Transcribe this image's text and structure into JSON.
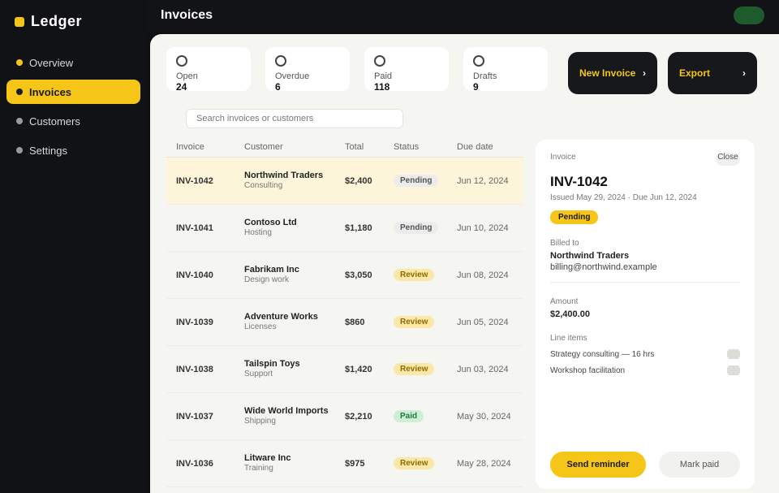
{
  "app": {
    "name": "Ledger",
    "page_title": "Invoices"
  },
  "sidebar": {
    "items": [
      {
        "label": "Overview"
      },
      {
        "label": "Invoices"
      },
      {
        "label": "Customers"
      },
      {
        "label": "Settings"
      }
    ]
  },
  "stats": [
    {
      "label": "Open",
      "value": "24"
    },
    {
      "label": "Overdue",
      "value": "6"
    },
    {
      "label": "Paid",
      "value": "118"
    },
    {
      "label": "Drafts",
      "value": "9"
    }
  ],
  "actions": {
    "new_invoice": "New Invoice",
    "export": "Export"
  },
  "search": {
    "placeholder": "Search invoices or customers"
  },
  "table": {
    "headers": [
      "Invoice",
      "Customer",
      "Total",
      "Status",
      "Due date"
    ],
    "rows": [
      {
        "id": "INV-1042",
        "name": "Northwind Traders",
        "desc": "Consulting",
        "amount": "$2,400",
        "status": "Pending",
        "due": "Jun 12, 2024"
      },
      {
        "id": "INV-1041",
        "name": "Contoso Ltd",
        "desc": "Hosting",
        "amount": "$1,180",
        "status": "Pending",
        "due": "Jun 10, 2024"
      },
      {
        "id": "INV-1040",
        "name": "Fabrikam Inc",
        "desc": "Design work",
        "amount": "$3,050",
        "status": "Review",
        "due": "Jun 08, 2024"
      },
      {
        "id": "INV-1039",
        "name": "Adventure Works",
        "desc": "Licenses",
        "amount": "$860",
        "status": "Review",
        "due": "Jun 05, 2024"
      },
      {
        "id": "INV-1038",
        "name": "Tailspin Toys",
        "desc": "Support",
        "amount": "$1,420",
        "status": "Review",
        "due": "Jun 03, 2024"
      },
      {
        "id": "INV-1037",
        "name": "Wide World Imports",
        "desc": "Shipping",
        "amount": "$2,210",
        "status": "Paid",
        "due": "May 30, 2024"
      },
      {
        "id": "INV-1036",
        "name": "Litware Inc",
        "desc": "Training",
        "amount": "$975",
        "status": "Review",
        "due": "May 28, 2024"
      }
    ]
  },
  "detail": {
    "label": "Invoice",
    "close": "Close",
    "title": "INV-1042",
    "subtitle": "Issued May 29, 2024 · Due Jun 12, 2024",
    "status": "Pending",
    "billed_to_label": "Billed to",
    "billed_to_name": "Northwind Traders",
    "billed_to_email": "billing@northwind.example",
    "amount_label": "Amount",
    "amount": "$2,400.00",
    "items_label": "Line items",
    "item1": "Strategy consulting — 16 hrs",
    "item2": "Workshop facilitation",
    "primary": "Send reminder",
    "secondary": "Mark paid"
  },
  "colors": {
    "accent": "#f5c518",
    "sidebar": "#111215",
    "surface": "#f5f5f2"
  }
}
